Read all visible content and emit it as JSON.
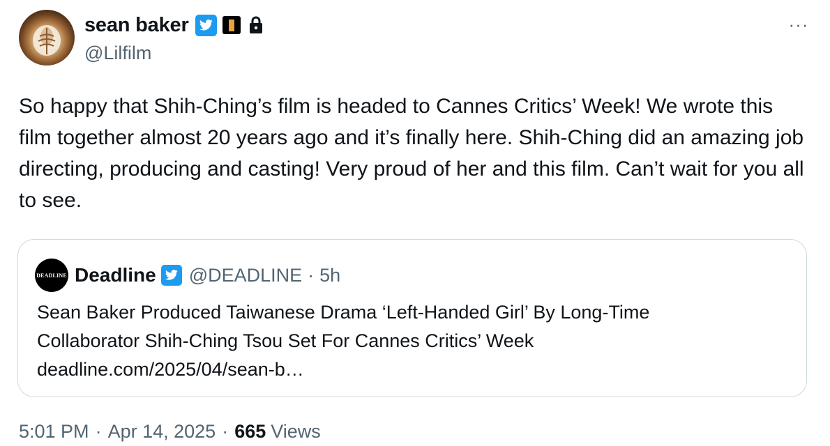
{
  "author": {
    "display_name": "sean baker",
    "handle": "@Lilfilm",
    "avatar_icon": "latte-art-avatar",
    "badges": [
      "verified-badge-icon",
      "affiliation-badge-icon",
      "lock-icon"
    ]
  },
  "more_menu": {
    "label": "···",
    "icon": "more-horizontal-icon"
  },
  "tweet": {
    "text": "So happy that Shih-Ching’s film is headed to Cannes Critics’ Week! We wrote this film together almost 20 years ago and it’s finally here. Shih-Ching did an amazing job directing, producing and casting! Very proud of her and this film. Can’t wait for you all to see."
  },
  "quote": {
    "logo_text": "DEADLINE",
    "display_name": "Deadline",
    "handle": "@DEADLINE",
    "separator": "·",
    "time": "5h",
    "text_line1": "Sean Baker Produced Taiwanese Drama ‘Left-Handed Girl’ By Long-Time",
    "text_line2": "Collaborator Shih-Ching Tsou Set For Cannes Critics’ Week",
    "link": "deadline.com/2025/04/sean-b…"
  },
  "footer": {
    "time": "5:01 PM",
    "sep1": "·",
    "date": "Apr 14, 2025",
    "sep2": "·",
    "views_count": "665",
    "views_label": "Views"
  },
  "colors": {
    "text": "#0f1419",
    "secondary": "#536471",
    "verified_blue": "#1d9bf0",
    "border": "#cfd9de",
    "affiliation_gold": "#e8a33d"
  }
}
